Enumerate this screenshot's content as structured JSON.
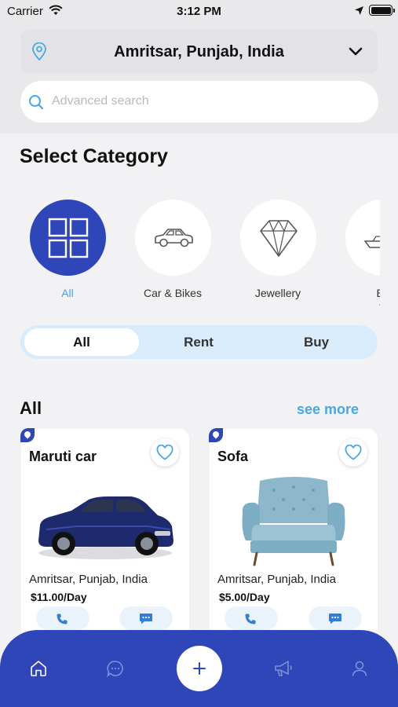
{
  "status_bar": {
    "carrier": "Carrier",
    "time": "3:12 PM"
  },
  "header": {
    "location": "Amritsar, Punjab, India",
    "search_placeholder": "Advanced search"
  },
  "category_section": {
    "title": "Select Category",
    "items": [
      {
        "label": "All",
        "icon": "grid-icon",
        "active": true
      },
      {
        "label": "Car & Bikes",
        "icon": "car-icon",
        "active": false
      },
      {
        "label": "Jewellery",
        "icon": "diamond-icon",
        "active": false
      },
      {
        "label": "Bo\nJe",
        "icon": "boat-icon",
        "active": false
      }
    ]
  },
  "segments": {
    "all": "All",
    "rent": "Rent",
    "buy": "Buy",
    "selected": "All"
  },
  "listing": {
    "title": "All",
    "see_more": "see more",
    "products": [
      {
        "name": "Maruti car",
        "location": "Amritsar, Punjab, India",
        "price": "$11.00/Day",
        "image": "blue-car-image"
      },
      {
        "name": "Sofa",
        "location": "Amritsar, Punjab, India",
        "price": "$5.00/Day",
        "image": "blue-armchair-image"
      }
    ]
  },
  "bottom_nav": {
    "items": [
      "home-icon",
      "chat-icon",
      "add-icon",
      "megaphone-icon",
      "profile-icon"
    ]
  },
  "colors": {
    "primary": "#2f46b8",
    "accent": "#49a8e2",
    "segment_bg": "#d8ecfb",
    "page_bg": "#f2f2f4"
  }
}
